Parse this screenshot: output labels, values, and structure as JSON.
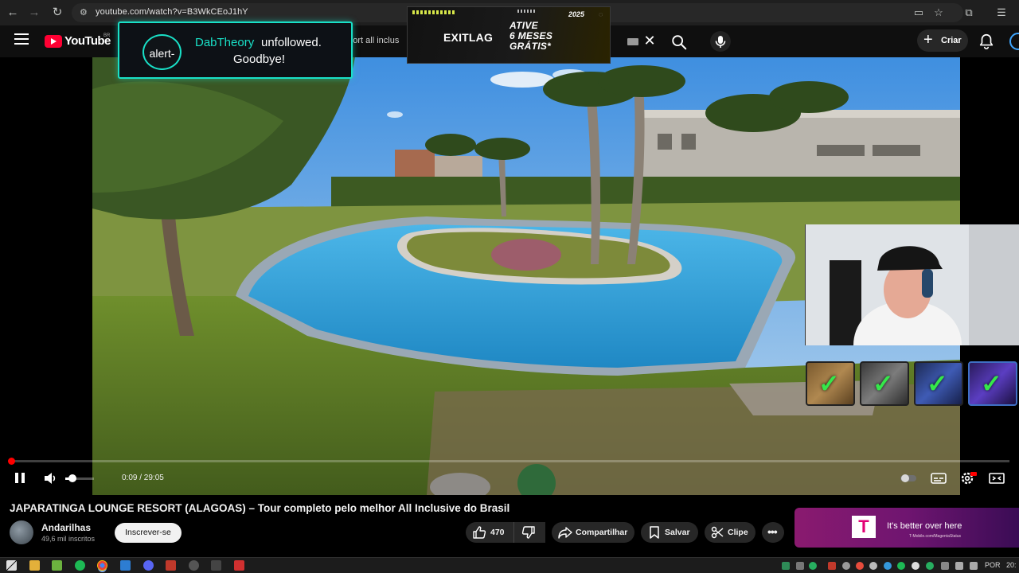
{
  "browser": {
    "url": "youtube.com/watch?v=B3WkCEoJ1hY"
  },
  "youtube": {
    "logo_text": "YouTube",
    "country_code": "BR",
    "search_query": "resort all inclus",
    "create_label": "Criar"
  },
  "ad_banner": {
    "brand": "EXITLAG",
    "headline_line1": "ATIVE",
    "headline_line2": "6 MESES",
    "headline_line3": "GRÁTIS*",
    "year": "2025"
  },
  "alert": {
    "logo_text": "alert-",
    "username": "DabTheory",
    "action": "unfollowed.",
    "message": "Goodbye!"
  },
  "player": {
    "current_time": "0:09",
    "duration": "29:05",
    "time_display": "0:09 / 29:05",
    "progress_fraction": 0.005,
    "volume_fraction": 0.3
  },
  "video": {
    "title": "JAPARATINGA LOUNGE RESORT (ALAGOAS) – Tour completo pelo melhor All Inclusive do Brasil",
    "channel_name": "Andarilhas",
    "subscribers": "49,6 mil inscritos",
    "subscribe_label": "Inscrever-se",
    "like_count": "470",
    "share_label": "Compartilhar",
    "save_label": "Salvar",
    "clip_label": "Clipe"
  },
  "side_ad": {
    "logo": "T",
    "text": "It's better over here",
    "url": "T-Mobile.com/MagentaStatus"
  },
  "taskbar": {
    "language": "POR",
    "clock": "20:"
  },
  "colors": {
    "youtube_red": "#ff0033",
    "alert_accent": "#19e0c7",
    "tmobile_magenta": "#e20074",
    "check_green": "#35e84a"
  }
}
